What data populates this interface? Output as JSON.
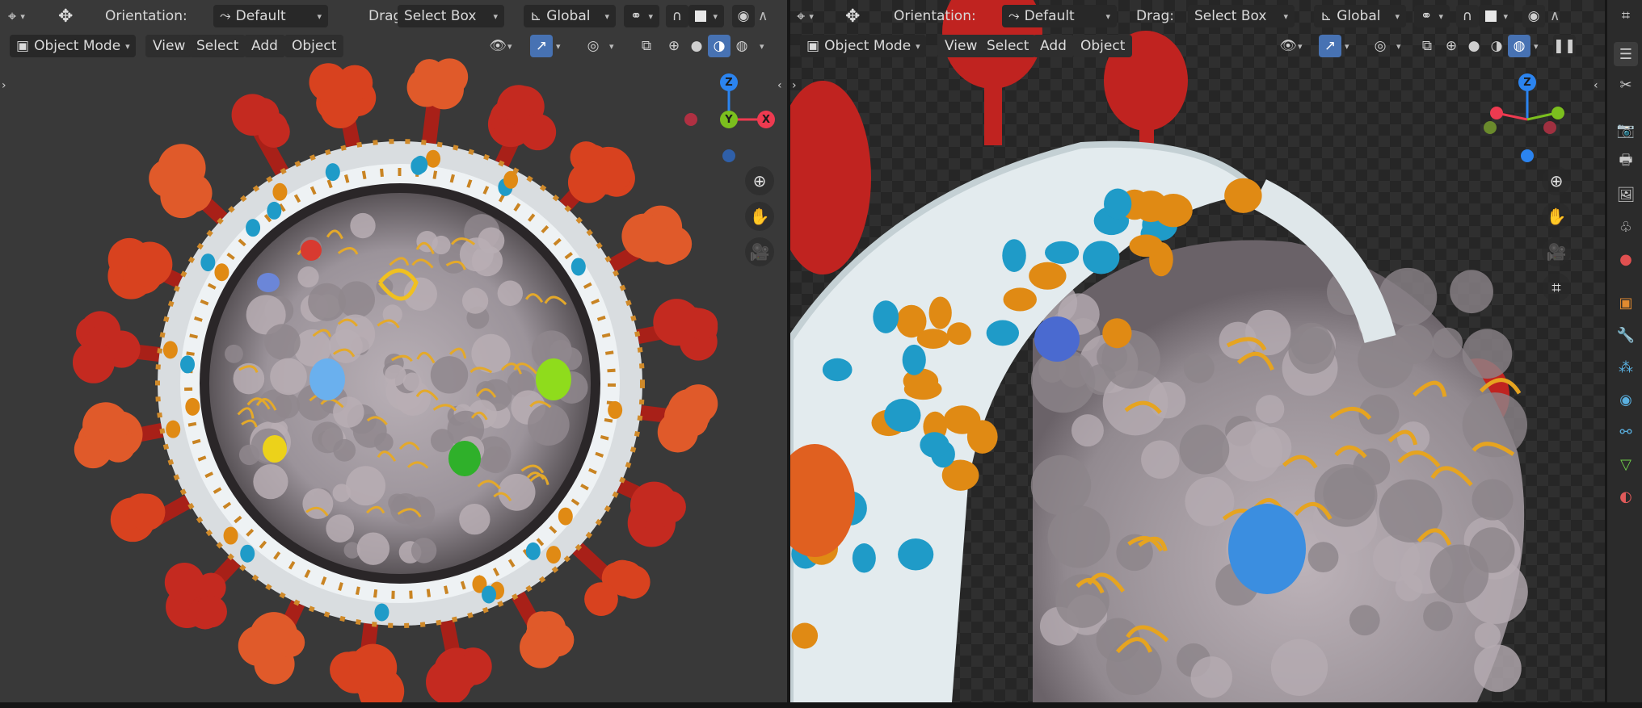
{
  "left_viewport": {
    "header": {
      "orientation_label": "Orientation:",
      "orientation_value": "Default",
      "drag_label": "Drag:",
      "drag_value": "Select Box",
      "transform_space": "Global",
      "mode": "Object Mode",
      "menus": [
        "View",
        "Select",
        "Add",
        "Object"
      ]
    },
    "gizmo": {
      "z": "Z",
      "y": "Y",
      "x": "X"
    }
  },
  "right_viewport": {
    "header": {
      "orientation_label": "Orientation:",
      "orientation_value": "Default",
      "drag_label": "Drag:",
      "drag_value": "Select Box",
      "transform_space": "Global",
      "mode": "Object Mode",
      "menus": [
        "View",
        "Select",
        "Add",
        "Object"
      ]
    },
    "gizmo": {
      "z": "Z"
    }
  },
  "colors": {
    "accent": "#4772b3",
    "axis_x": "#ee3a50",
    "axis_y": "#7bbf1e",
    "axis_z": "#2b84f0",
    "spike_red": "#c62a22",
    "capsid_grey": "#a79ea5",
    "membrane_white": "#e6eef0",
    "protein_orange": "#e08a14"
  }
}
